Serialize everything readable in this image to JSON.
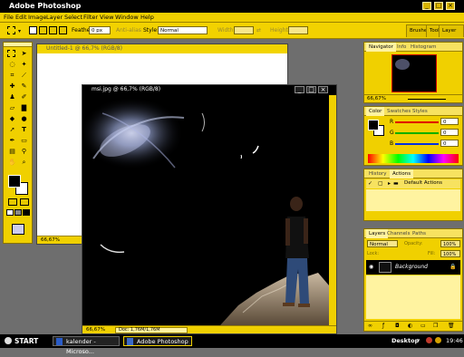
{
  "app": {
    "title": "Adobe Photoshop"
  },
  "menu": [
    "File",
    "Edit",
    "Image",
    "Layer",
    "Select",
    "Filter",
    "View",
    "Window",
    "Help"
  ],
  "options": {
    "feather_label": "Feather:",
    "feather_value": "0 px",
    "antialias_label": "Anti-alias",
    "style_label": "Style:",
    "style_value": "Normal",
    "width_label": "Width:",
    "height_label": "Height:",
    "dock_tabs": [
      "Brushes",
      "Tool Presets",
      "Layer"
    ]
  },
  "documents": {
    "untitled": {
      "title": "Untitled-1 @ 66,7% (RGB/8)",
      "zoom": "66,67%"
    },
    "msi": {
      "title": "msi.jpg @ 66,7% (RGB/8)",
      "zoom": "66,67%",
      "doc_info": "Doc: 1,76M/1,76M"
    }
  },
  "navigator": {
    "tabs": [
      "Navigator",
      "Info",
      "Histogram"
    ],
    "zoom": "66,67%"
  },
  "color": {
    "tabs": [
      "Color",
      "Swatches",
      "Styles"
    ],
    "channels": [
      {
        "label": "R",
        "value": "0",
        "color": "#e00000"
      },
      {
        "label": "G",
        "value": "0",
        "color": "#00b000"
      },
      {
        "label": "B",
        "value": "0",
        "color": "#0030e0"
      }
    ]
  },
  "history": {
    "tabs": [
      "History",
      "Actions"
    ],
    "item": "Default Actions"
  },
  "layers": {
    "tabs": [
      "Layers",
      "Channels",
      "Paths"
    ],
    "mode": "Normal",
    "opacity_label": "Opacity:",
    "opacity_value": "100%",
    "lock_label": "Lock:",
    "fill_label": "Fill:",
    "fill_value": "100%",
    "layer_name": "Background"
  },
  "taskbar": {
    "start": "START",
    "items": [
      "kalender - Microso...",
      "Adobe Photoshop"
    ],
    "desktop": "Desktop",
    "clock": "19:46"
  },
  "colors": {
    "accent": "#f0d000",
    "dark": "#000000",
    "canvas": "#ffffff"
  }
}
